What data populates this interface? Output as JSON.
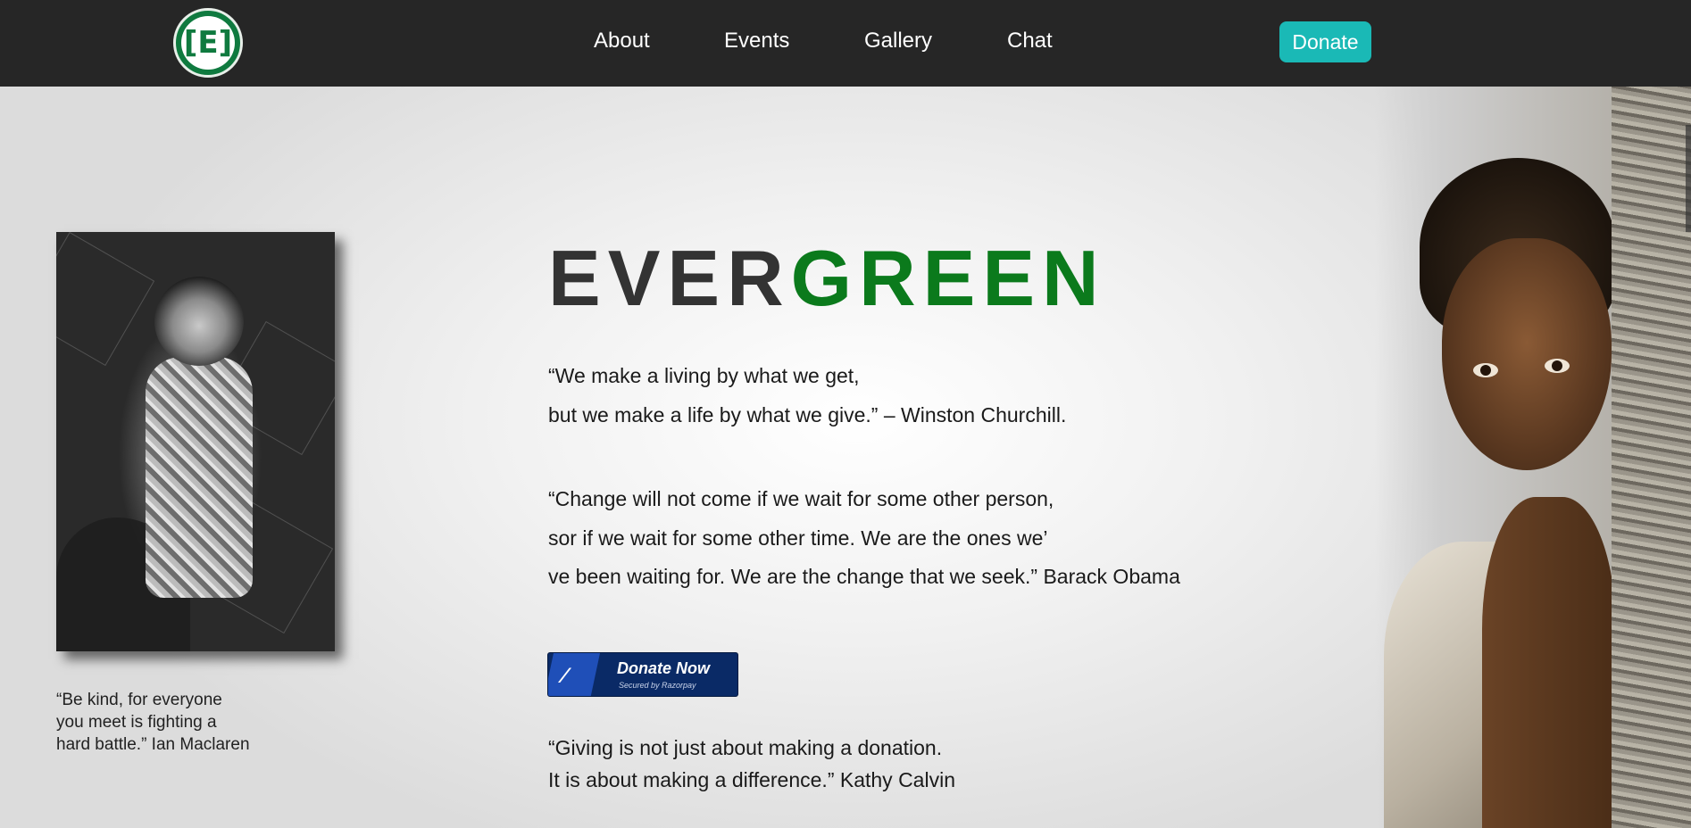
{
  "header": {
    "logo_text": "[E]",
    "nav": [
      {
        "label": "About"
      },
      {
        "label": "Events"
      },
      {
        "label": "Gallery"
      },
      {
        "label": "Chat"
      }
    ],
    "donate_label": "Donate"
  },
  "left": {
    "caption_lines": [
      "“Be kind, for everyone",
      "you meet is fighting a",
      "hard battle.” Ian Maclaren"
    ]
  },
  "main": {
    "brand_dark": "EVER",
    "brand_green": "GREEN",
    "quote1": [
      "“We make a living by what we get,",
      "but we make a life by what we give.” – Winston Churchill."
    ],
    "quote2": [
      "“Change will not come if we wait for some other person,",
      "sor if we wait for some other time. We are the ones we’",
      "ve been waiting for. We are the change that we seek.” Barack Obama"
    ],
    "donate_now": {
      "label": "Donate Now",
      "secured": "Secured by Razorpay"
    },
    "quote3": [
      "“Giving is not just about making a donation.",
      "It is about making a difference.” Kathy Calvin"
    ]
  },
  "colors": {
    "nav_bg": "#262626",
    "accent_teal": "#1ab9b6",
    "brand_green": "#0b7a1c",
    "razorpay_navy": "#0a2a66"
  }
}
